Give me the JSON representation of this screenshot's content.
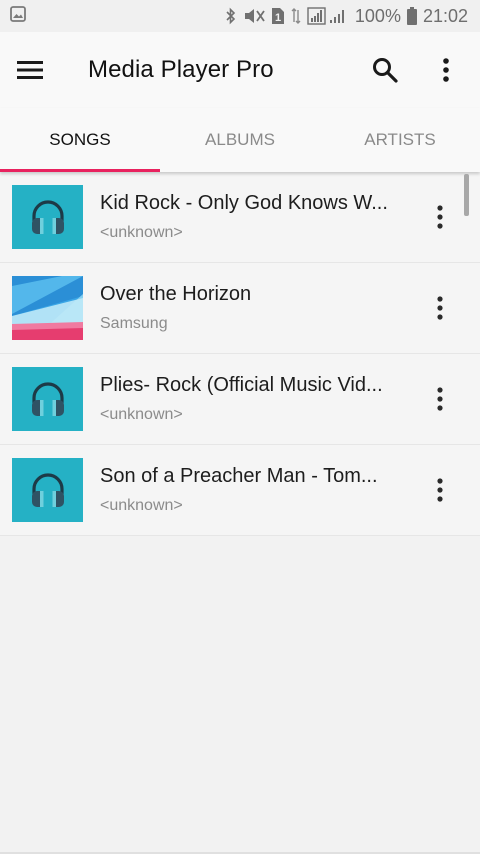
{
  "status_bar": {
    "battery_text": "100%",
    "time": "21:02",
    "sim_badge": "1",
    "icons": [
      "gallery-notification-icon",
      "bluetooth-icon",
      "mute-icon",
      "sim-icon",
      "data-icon",
      "signal-icon",
      "battery-icon"
    ]
  },
  "app_bar": {
    "title": "Media Player Pro",
    "icons": [
      "menu-icon",
      "search-icon",
      "more-vert-icon"
    ]
  },
  "tabs": [
    {
      "label": "SONGS",
      "active": true
    },
    {
      "label": "ALBUMS",
      "active": false
    },
    {
      "label": "ARTISTS",
      "active": false
    }
  ],
  "songs": [
    {
      "title": "Kid Rock - Only God Knows W...",
      "artist": "<unknown>",
      "art": "headphones-art"
    },
    {
      "title": "Over the Horizon",
      "artist": "Samsung",
      "art": "abstract-art"
    },
    {
      "title": "Plies- Rock (Official Music Vid...",
      "artist": "<unknown>",
      "art": "headphones-art"
    },
    {
      "title": "Son of a Preacher Man - Tom...",
      "artist": "<unknown>",
      "art": "headphones-art"
    }
  ],
  "colors": {
    "accent": "#e8225e",
    "art_teal": "#25b1c5",
    "headphone_dark": "#2f5364",
    "headphone_band": "#1d3a47"
  }
}
